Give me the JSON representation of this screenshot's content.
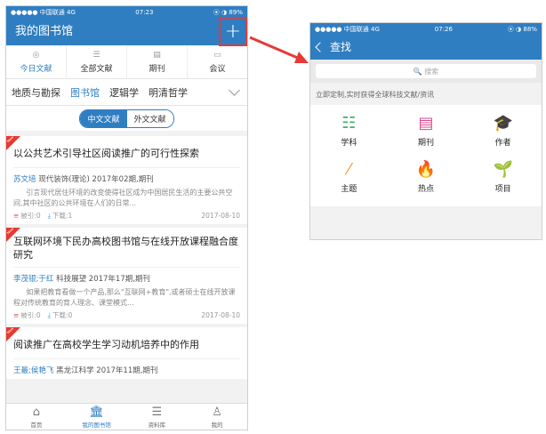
{
  "left": {
    "status": {
      "carrier": "●●●●● 中国联通 4G",
      "time": "07:23",
      "battery": "⦿ ◑ 89%"
    },
    "nav": {
      "title": "我的图书馆",
      "plus": "+"
    },
    "tabs": [
      {
        "label": "今日文献",
        "icon": "◎"
      },
      {
        "label": "全部文献",
        "icon": "☰"
      },
      {
        "label": "期刊",
        "icon": "▤"
      },
      {
        "label": "会议",
        "icon": "▭"
      }
    ],
    "subjects": [
      "地质与勘探",
      "图书馆",
      "逻辑学",
      "明清哲学"
    ],
    "segment": {
      "on": "中文文献",
      "off": "外文文献"
    },
    "articles": [
      {
        "title": "以公共艺术引导社区阅读推广的可行性探索",
        "authors": "苏文培",
        "source": "现代装饰(理论) 2017年02期,期刊",
        "abstract": "引言现代居住环境的改变使得社区成为中国居民生活的主要公共空间,其中社区的公共环境在人们的日常...",
        "cited": "被引:0",
        "downloads": "下载:1",
        "date": "2017-08-10"
      },
      {
        "title": "互联网环境下民办高校图书馆与在线开放课程融合度研究",
        "authors": "李茂银;于红",
        "source": "科技展望 2017年17期,期刊",
        "abstract": "如果把教育看做一个产品,那么\"互联网+教育\",或者硕士在线开放课程对传统教育的育人理念、课堂模式...",
        "cited": "被引:0",
        "downloads": "下载:0",
        "date": "2017-08-10"
      },
      {
        "title": "阅读推广在高校学生学习动机培养中的作用",
        "authors": "王最;侯艳飞",
        "source": "黑龙江科学 2017年11期,期刊"
      }
    ],
    "ribbon": "New",
    "bottom": [
      {
        "label": "首页",
        "icon": "⌂"
      },
      {
        "label": "我的图书馆",
        "icon": "🏛"
      },
      {
        "label": "资料库",
        "icon": "☰"
      },
      {
        "label": "我的",
        "icon": "♙"
      }
    ]
  },
  "right": {
    "status": {
      "carrier": "●●●●● 中国联通 4G",
      "time": "07:26",
      "battery": "⦿ ◑ 88%"
    },
    "nav": {
      "title": "查找"
    },
    "search": {
      "placeholder": "🔍 搜索"
    },
    "promo": "立即定制,实时获得全球科技文献/资讯",
    "grid": [
      {
        "label": "学科",
        "icon": "☷",
        "color": "#3db36b"
      },
      {
        "label": "期刊",
        "icon": "▤",
        "color": "#d94a8c"
      },
      {
        "label": "作者",
        "icon": "🎓",
        "color": "#8a6fc4"
      },
      {
        "label": "主题",
        "icon": "⁄",
        "color": "#f0a030"
      },
      {
        "label": "热点",
        "icon": "🔥",
        "color": "#e24a3a"
      },
      {
        "label": "项目",
        "icon": "🌱",
        "color": "#2f9fd9"
      }
    ]
  },
  "colors": {
    "accent": "#2f7ec2",
    "highlight": "#e53a36"
  }
}
